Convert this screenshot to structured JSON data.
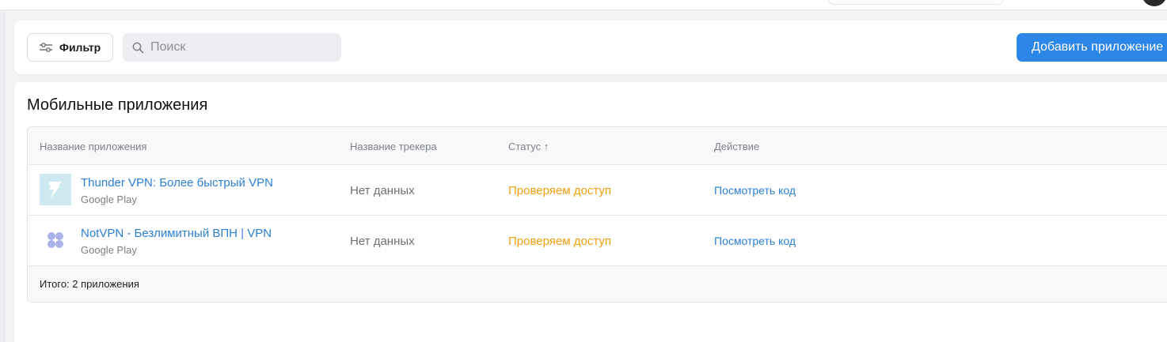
{
  "toolbar": {
    "filter_label": "Фильтр",
    "search_placeholder": "Поиск",
    "add_button_label": "Добавить приложение"
  },
  "section": {
    "title": "Мобильные приложения"
  },
  "table": {
    "columns": [
      "Название приложения",
      "Название трекера",
      "Статус ↑",
      "Действие"
    ],
    "rows": [
      {
        "app_name": "Thunder VPN: Более быстрый VPN",
        "store": "Google Play",
        "tracker": "Нет данных",
        "status": "Проверяем доступ",
        "action": "Посмотреть код",
        "icon": "thunder-vpn-icon"
      },
      {
        "app_name": "NotVPN - Безлимитный ВПН | VPN",
        "store": "Google Play",
        "tracker": "Нет данных",
        "status": "Проверяем доступ",
        "action": "Посмотреть код",
        "icon": "notvpn-icon"
      }
    ],
    "footer_total": "Итого: 2 приложения"
  },
  "colors": {
    "accent": "#2b86e8",
    "link": "#2b7fd6",
    "status_pending": "#f59e0b"
  }
}
